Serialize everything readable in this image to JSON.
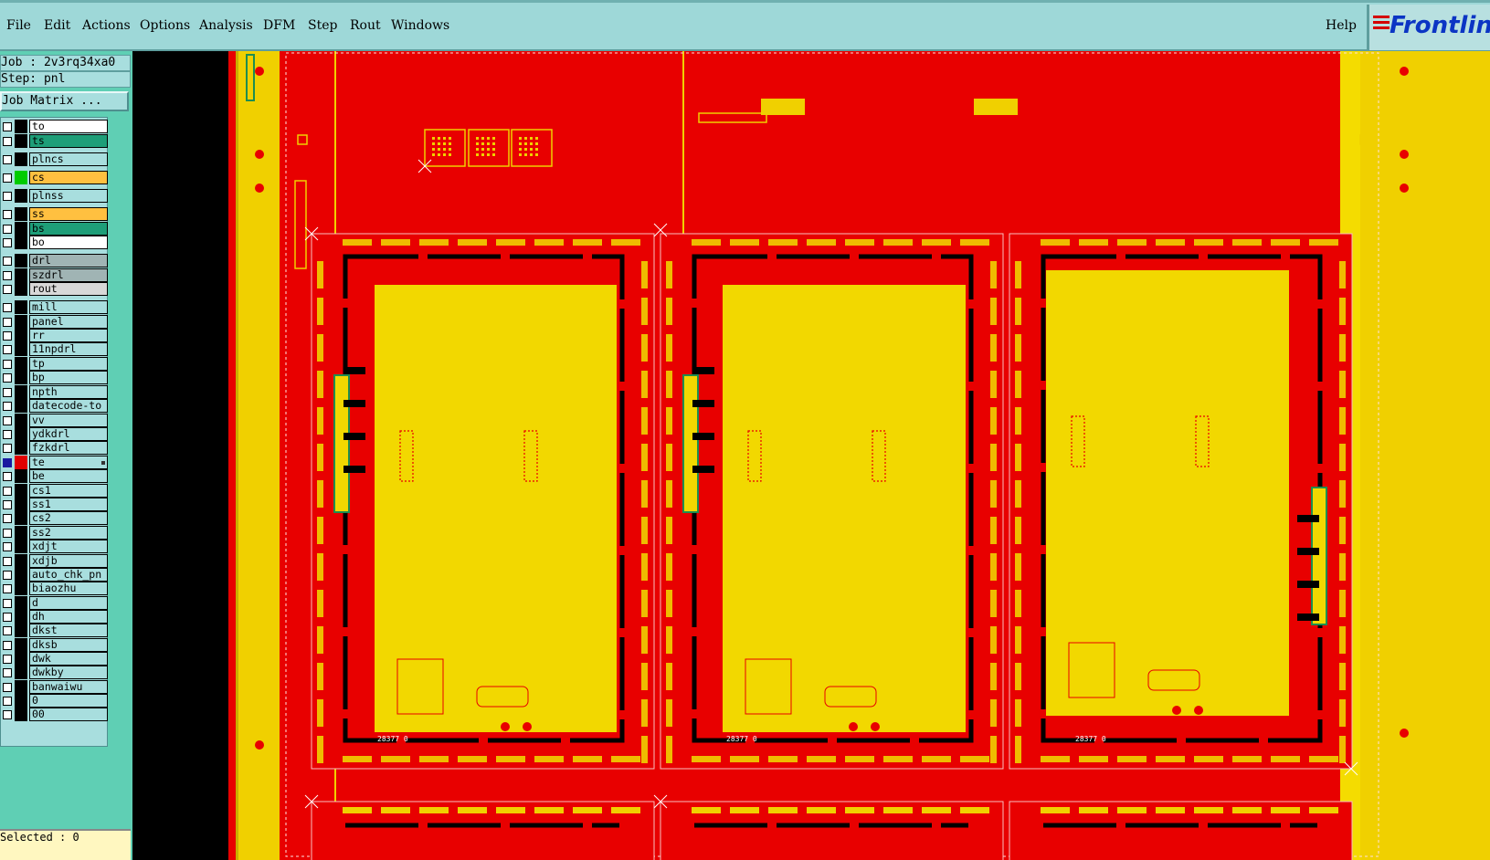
{
  "menubar": {
    "items": [
      "File",
      "Edit",
      "Actions",
      "Options",
      "Analysis",
      "DFM",
      "Step",
      "Rout",
      "Windows"
    ],
    "help": "Help",
    "logo": "Frontline"
  },
  "panel": {
    "job": "Job : 2v3rq34xa0",
    "step": "Step: pnl",
    "matrix_button": "Job Matrix ...",
    "selected": "Selected : 0"
  },
  "layers": [
    {
      "name": "to",
      "color": "#ffffff",
      "swatch": "#000000"
    },
    {
      "name": "ts",
      "color": "#1e9e78",
      "swatch": "#000000"
    },
    {
      "name": "plncs",
      "color": "#a8dede",
      "swatch": "#000000"
    },
    {
      "name": "cs",
      "color": "#ffc040",
      "swatch": "#00cc00"
    },
    {
      "name": "plnss",
      "color": "#a8dede",
      "swatch": "#000000"
    },
    {
      "name": "ss",
      "color": "#ffc040",
      "swatch": "#000000"
    },
    {
      "name": "bs",
      "color": "#1e9e78",
      "swatch": "#000000"
    },
    {
      "name": "bo",
      "color": "#ffffff",
      "swatch": "#000000"
    },
    {
      "name": "drl",
      "color": "#a0b4b4",
      "swatch": "#000000"
    },
    {
      "name": "szdrl",
      "color": "#a0b4b4",
      "swatch": "#000000"
    },
    {
      "name": "rout",
      "color": "#d8d8d8",
      "swatch": "#000000"
    },
    {
      "name": "mill",
      "color": "#a8dede",
      "swatch": "#000000"
    },
    {
      "name": "panel",
      "color": "#a8dede",
      "swatch": "#000000"
    },
    {
      "name": "rr",
      "color": "#a8dede",
      "swatch": "#000000"
    },
    {
      "name": "11npdrl",
      "color": "#a8dede",
      "swatch": "#000000"
    },
    {
      "name": "tp",
      "color": "#a8dede",
      "swatch": "#000000"
    },
    {
      "name": "bp",
      "color": "#a8dede",
      "swatch": "#000000"
    },
    {
      "name": "npth",
      "color": "#a8dede",
      "swatch": "#000000"
    },
    {
      "name": "datecode-to",
      "color": "#a8dede",
      "swatch": "#000000"
    },
    {
      "name": "vv",
      "color": "#a8dede",
      "swatch": "#000000"
    },
    {
      "name": "ydkdrl",
      "color": "#a8dede",
      "swatch": "#000000"
    },
    {
      "name": "fzkdrl",
      "color": "#a8dede",
      "swatch": "#000000"
    },
    {
      "name": "te",
      "color": "#a8dede",
      "swatch": "#e00000",
      "active": true
    },
    {
      "name": "be",
      "color": "#a8dede",
      "swatch": "#000000"
    },
    {
      "name": "cs1",
      "color": "#a8dede",
      "swatch": "#000000"
    },
    {
      "name": "ss1",
      "color": "#a8dede",
      "swatch": "#000000"
    },
    {
      "name": "cs2",
      "color": "#a8dede",
      "swatch": "#000000"
    },
    {
      "name": "ss2",
      "color": "#a8dede",
      "swatch": "#000000"
    },
    {
      "name": "xdjt",
      "color": "#a8dede",
      "swatch": "#000000"
    },
    {
      "name": "xdjb",
      "color": "#a8dede",
      "swatch": "#000000"
    },
    {
      "name": "auto_chk_pn",
      "color": "#a8dede",
      "swatch": "#000000"
    },
    {
      "name": "biaozhu",
      "color": "#a8dede",
      "swatch": "#000000"
    },
    {
      "name": "d",
      "color": "#a8dede",
      "swatch": "#000000"
    },
    {
      "name": "dh",
      "color": "#a8dede",
      "swatch": "#000000"
    },
    {
      "name": "dkst",
      "color": "#a8dede",
      "swatch": "#000000"
    },
    {
      "name": "dksb",
      "color": "#a8dede",
      "swatch": "#000000"
    },
    {
      "name": "dwk",
      "color": "#a8dede",
      "swatch": "#000000"
    },
    {
      "name": "dwkby",
      "color": "#a8dede",
      "swatch": "#000000"
    },
    {
      "name": "banwaiwu",
      "color": "#a8dede",
      "swatch": "#000000"
    },
    {
      "name": "0",
      "color": "#a8dede",
      "swatch": "#000000"
    },
    {
      "name": "00",
      "color": "#a8dede",
      "swatch": "#000000"
    }
  ],
  "board": {
    "units": [
      {
        "label": "28377 0"
      },
      {
        "label": "28377 0"
      },
      {
        "label": "28377 0"
      }
    ],
    "colors": {
      "copper": "#e80000",
      "board": "#f2d800",
      "rail": "#f0d000",
      "outline": "#000000"
    }
  }
}
